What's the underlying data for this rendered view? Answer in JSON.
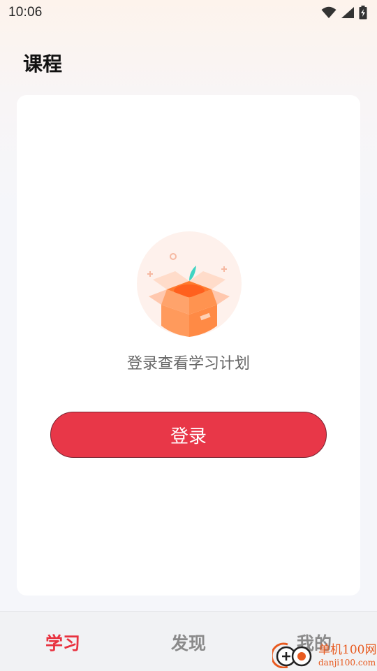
{
  "status_bar": {
    "time": "10:06",
    "icons": [
      "wifi-icon",
      "signal-icon",
      "battery-charging-icon"
    ]
  },
  "header": {
    "title": "课程"
  },
  "empty_state": {
    "illustration": "open-box-icon",
    "message": "登录查看学习计划",
    "login_button_label": "登录"
  },
  "bottom_nav": {
    "items": [
      {
        "label": "学习",
        "active": true
      },
      {
        "label": "发现",
        "active": false
      },
      {
        "label": "我的",
        "active": false
      }
    ]
  },
  "watermark": {
    "brand": "单机100网",
    "url": "danji100.com"
  },
  "colors": {
    "accent": "#e83748",
    "nav_active": "#e8323f",
    "nav_inactive": "#8a8a8a",
    "watermark": "#e85a1f"
  }
}
